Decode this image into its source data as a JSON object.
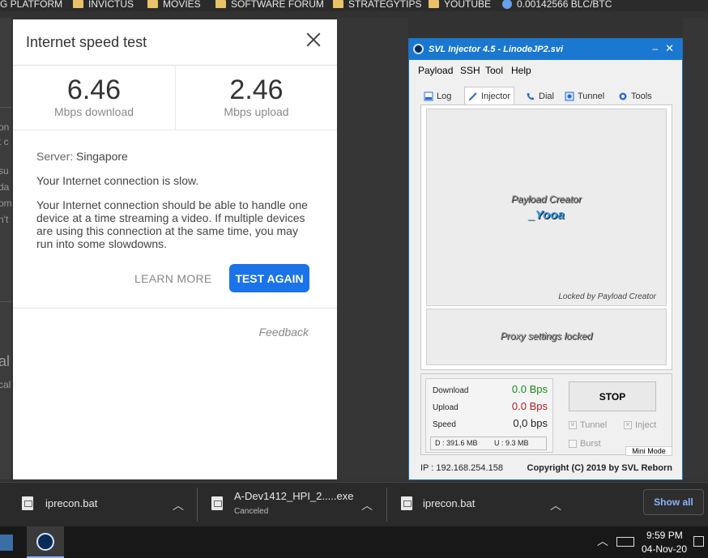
{
  "bookmarks": [
    {
      "label": "G PLATFORM",
      "icon": "folder-icon"
    },
    {
      "label": "INVICTUS",
      "icon": "folder-icon"
    },
    {
      "label": "MOVIES",
      "icon": "folder-icon"
    },
    {
      "label": "SOFTWARE FORUM",
      "icon": "folder-icon"
    },
    {
      "label": "STRATEGYTIPS",
      "icon": "folder-icon"
    },
    {
      "label": "YOUTUBE",
      "icon": "folder-icon"
    },
    {
      "label": "0.00142566 BLC/BTC",
      "icon": "globe-icon"
    }
  ],
  "page_fragments": [
    "on",
    "t c",
    "su",
    "da",
    "om",
    "n't",
    "al",
    "cal"
  ],
  "speedtest": {
    "title": "Internet speed test",
    "download_value": "6.46",
    "download_label": "Mbps download",
    "upload_value": "2.46",
    "upload_label": "Mbps upload",
    "server_label": "Server:",
    "server_value": "Singapore",
    "slow_text": "Your Internet connection is slow.",
    "detail_text": "Your Internet connection should be able to handle one device at a time streaming a video. If multiple devices are using this connection at the same time, you may run into some slowdowns.",
    "learn_more": "LEARN MORE",
    "test_again": "TEST AGAIN",
    "feedback": "Feedback"
  },
  "svl": {
    "title": "SVL Injector 4.5 - LinodeJP2.svi",
    "minimize": "–",
    "close": "✕",
    "menu": [
      "Payload",
      "SSH",
      "Tool",
      "Help"
    ],
    "tabs": [
      {
        "label": "Log",
        "icon": "log-icon"
      },
      {
        "label": "Injector",
        "icon": "syringe-icon"
      },
      {
        "label": "Dial",
        "icon": "phone-icon"
      },
      {
        "label": "Tunnel",
        "icon": "tunnel-icon"
      },
      {
        "label": "Tools",
        "icon": "tools-icon"
      }
    ],
    "active_tab": "Injector",
    "payload_creator": "Payload Creator",
    "creator_name": "_Yooa",
    "locked_by": "Locked by Payload Creator",
    "proxy_locked": "Proxy settings locked",
    "download_label": "Download",
    "download_value": "0.0 Bps",
    "upload_label": "Upload",
    "upload_value": "0.0 Bps",
    "speed_label": "Speed",
    "speed_value": "0,0 bps",
    "d_total": "D :  391.6 MB",
    "u_total": "U :     9.3 MB",
    "stop_button": "STOP",
    "tunnel_check": "Tunnel",
    "inject_check": "Inject",
    "burst_check": "Burst",
    "mini_mode": "Mini Mode",
    "ip_text": "IP : 192.168.254.158",
    "copyright": "Copyright (C) 2019 by SVL Reborn"
  },
  "downloads": [
    {
      "name": "iprecon.bat",
      "sub": ""
    },
    {
      "name": "A-Dev1412_HPI_2.....exe",
      "sub": "Canceled"
    },
    {
      "name": "iprecon.bat",
      "sub": ""
    }
  ],
  "show_all": "Show all",
  "taskbar": {
    "time": "9:59 PM",
    "date": "04-Nov-20"
  },
  "colors": {
    "accent_blue": "#1a73e8",
    "svl_title": "#1a78d0",
    "green": "#1a8a1a",
    "red": "#b32020"
  }
}
